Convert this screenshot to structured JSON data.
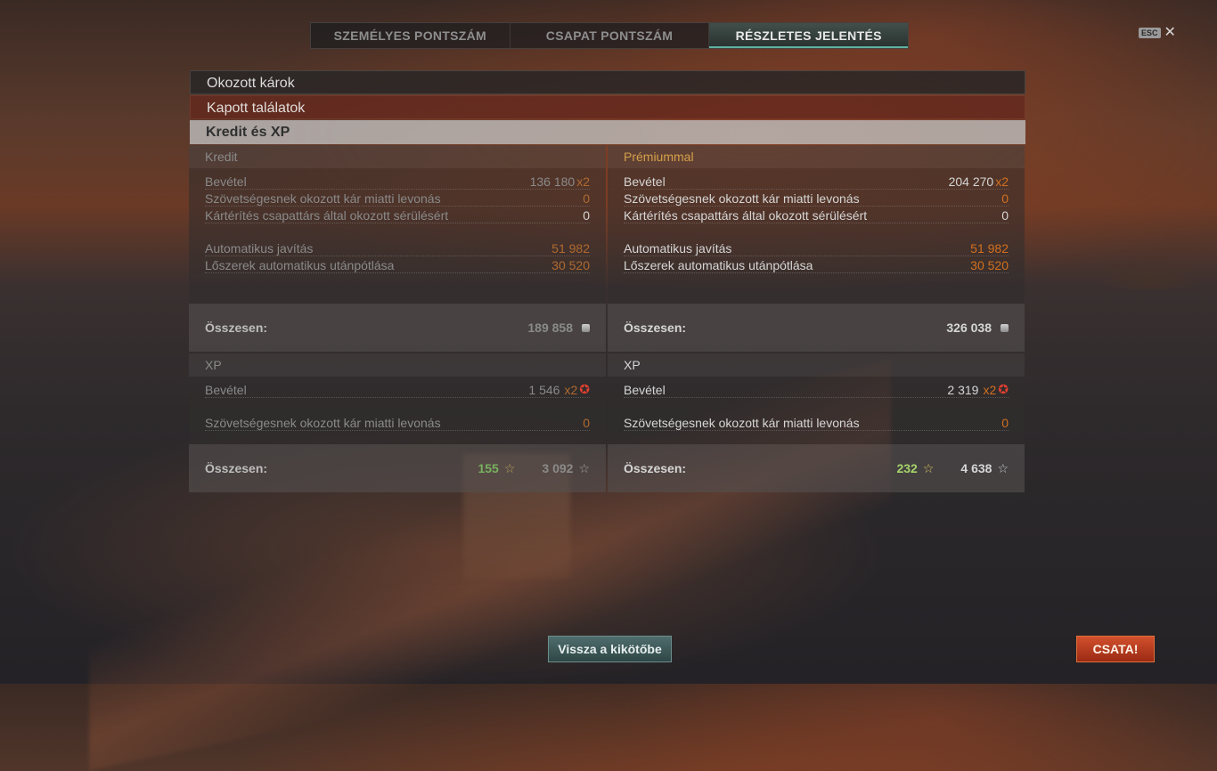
{
  "tabs": [
    {
      "label": "SZEMÉLYES PONTSZÁM"
    },
    {
      "label": "CSAPAT PONTSZÁM"
    },
    {
      "label": "RÉSZLETES JELENTÉS"
    }
  ],
  "esc": {
    "key": "ESC",
    "close": "✕"
  },
  "sections": {
    "damage_dealt": "Okozott károk",
    "hits_received": "Kapott találatok",
    "credit_xp": "Kredit és XP"
  },
  "credit": {
    "title": "Kredit",
    "rows": [
      {
        "label": "Bevétel",
        "value": "136 180",
        "multiplier": "x2"
      },
      {
        "label": "Szövetségesnek okozott kár miatti levonás",
        "value": "0"
      },
      {
        "label": "Kártérítés csapattárs által okozott sérülésért",
        "value": "0"
      },
      {
        "label": "Automatikus javítás",
        "value": "51 982"
      },
      {
        "label": "Lőszerek automatikus utánpótlása",
        "value": "30 520"
      }
    ],
    "total_label": "Összesen:",
    "total": "189 858"
  },
  "premium": {
    "title": "Prémiummal",
    "rows": [
      {
        "label": "Bevétel",
        "value": "204 270",
        "multiplier": "x2"
      },
      {
        "label": "Szövetségesnek okozott kár miatti levonás",
        "value": "0"
      },
      {
        "label": "Kártérítés csapattárs által okozott sérülésért",
        "value": "0"
      },
      {
        "label": "Automatikus javítás",
        "value": "51 982"
      },
      {
        "label": "Lőszerek automatikus utánpótlása",
        "value": "30 520"
      }
    ],
    "total_label": "Összesen:",
    "total": "326 038"
  },
  "xp": {
    "title": "XP",
    "rows": [
      {
        "label": "Bevétel",
        "value": "1 546",
        "multiplier": "x2"
      },
      {
        "label": "Szövetségesnek okozott kár miatti levonás",
        "value": "0"
      }
    ],
    "total_label": "Összesen:",
    "total_ship": "155",
    "total_free": "3 092"
  },
  "xp_premium": {
    "title": "XP",
    "rows": [
      {
        "label": "Bevétel",
        "value": "2 319",
        "multiplier": "x2"
      },
      {
        "label": "Szövetségesnek okozott kár miatti levonás",
        "value": "0"
      }
    ],
    "total_label": "Összesen:",
    "total_ship": "232",
    "total_free": "4 638"
  },
  "buttons": {
    "back_to_port": "Vissza a kikötőbe",
    "battle": "CSATA!"
  },
  "icons": {
    "star": "☆",
    "red_star": "✪"
  },
  "colors": {
    "accent_teal": "#5fb3a0",
    "orange_value": "#d2701f",
    "premium_gold": "#d4a04a",
    "battle_red": "#c0401e"
  }
}
